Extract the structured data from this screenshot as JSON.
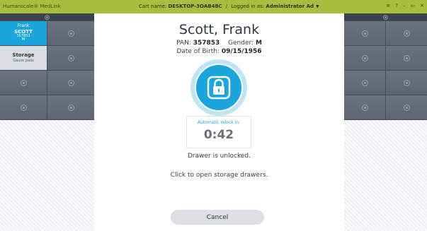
{
  "topbar": {
    "brand": "Humanscale® MedLink",
    "cart_label": "Cart name:",
    "cart_name": "DESKTOP-3OAB48C",
    "separator": "/",
    "logged_label": "Logged in as:",
    "user": "Administrator Ad",
    "controls": [
      "≡",
      "?",
      "–",
      "▭",
      "✕"
    ]
  },
  "sidebar_left": {
    "patient": {
      "first": "Frank",
      "last": "SCOTT",
      "pan": "357853",
      "gender": "M"
    },
    "storage": {
      "title": "Storage",
      "subtitle": "Gauze pads"
    }
  },
  "patient": {
    "full_name": "Scott, Frank",
    "pan_label": "PAN:",
    "pan": "357853",
    "gender_label": "Gender:",
    "gender": "M",
    "dob_label": "Date of Birth:",
    "dob": "09/15/1956"
  },
  "relock": {
    "label": "Automatic relock in:",
    "time": "0:42"
  },
  "status_text": "Drawer is unlocked.",
  "hint_text": "Click to open storage drawers.",
  "cancel_label": "Cancel",
  "colors": {
    "accent": "#1aa6dd",
    "topbar": "#a9be3e",
    "panel": "#5d6572"
  }
}
